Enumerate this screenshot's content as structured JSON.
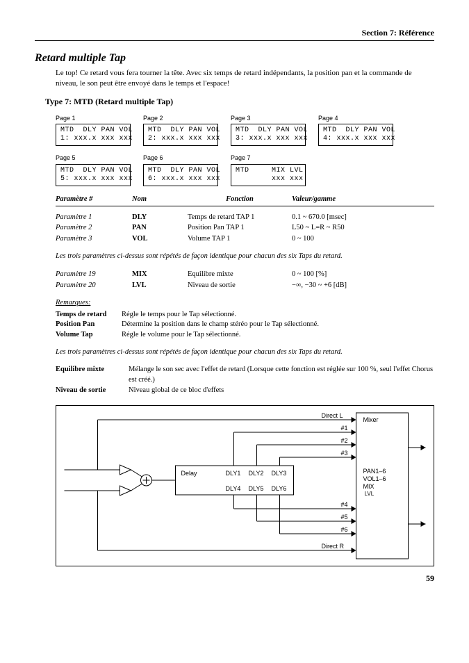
{
  "section_header": "Section 7: Référence",
  "title": "Retard multiple Tap",
  "intro": "Le top! Ce retard vous fera tourner la tête. Avec six temps de retard indépendants, la position pan et la commande de niveau, le son peut être envoyé dans le temps et l'espace!",
  "type_heading": "Type 7: MTD (Retard multiple Tap)",
  "pages": [
    {
      "label": "Page 1",
      "line1": "MTD  DLY PAN VOL",
      "line2": "1: xxx.x xxx xxx"
    },
    {
      "label": "Page 2",
      "line1": "MTD  DLY PAN VOL",
      "line2": "2: xxx.x xxx xxx"
    },
    {
      "label": "Page 3",
      "line1": "MTD  DLY PAN VOL",
      "line2": "3: xxx.x xxx xxx"
    },
    {
      "label": "Page 4",
      "line1": "MTD  DLY PAN VOL",
      "line2": "4: xxx.x xxx xxx"
    },
    {
      "label": "Page 5",
      "line1": "MTD  DLY PAN VOL",
      "line2": "5: xxx.x xxx xxx"
    },
    {
      "label": "Page 6",
      "line1": "MTD  DLY PAN VOL",
      "line2": "6: xxx.x xxx xxx"
    },
    {
      "label": "Page 7",
      "line1": "MTD     MIX LVL",
      "line2": "        xxx xxx"
    }
  ],
  "header": {
    "c1": "Paramètre #",
    "c2": "Nom",
    "c3": "Fonction",
    "c4": "Valeur/gamme"
  },
  "params1": [
    {
      "c1": "Paramètre 1",
      "c2": "DLY",
      "c3": "Temps de retard TAP 1",
      "c4": "0.1 ~ 670.0 [msec]"
    },
    {
      "c1": "Paramètre 2",
      "c2": "PAN",
      "c3": "Position Pan TAP 1",
      "c4": "L50 ~ L=R ~ R50"
    },
    {
      "c1": "Paramètre 3",
      "c2": "VOL",
      "c3": "Volume TAP 1",
      "c4": "0 ~ 100"
    }
  ],
  "note1": "Les trois paramètres ci-dessus sont répétés de façon identique pour chacun des six Taps du retard.",
  "params2": [
    {
      "c1": "Paramètre 19",
      "c2": "MIX",
      "c3": "Equilibre mixte",
      "c4": "0 ~ 100 [%]"
    },
    {
      "c1": "Paramètre 20",
      "c2": "LVL",
      "c3": "Niveau de sortie",
      "c4": "−∞, −30 ~ +6 [dB]"
    }
  ],
  "remarks_heading": "Remarques:",
  "remarks": [
    {
      "label": "Temps de retard",
      "text": "Régle le temps pour le Tap sélectionné."
    },
    {
      "label": "Position Pan",
      "text": "Détermine la position dans le champ stéréo pour le Tap sélectionné."
    },
    {
      "label": "Volume Tap",
      "text": "Régle le volume pour le Tap sélectionné."
    }
  ],
  "note2": "Les trois paramètres ci-dessus sont répétés de façon identique pour chacun des six Taps du retard.",
  "defs": [
    {
      "label": "Equilibre mixte",
      "text": "Mélange le son sec avec l'effet de retard (Lorsque cette fonction est réglée sur 100 %, seul l'effet Chorus est créé.)"
    },
    {
      "label": "Niveau de sortie",
      "text": "Niveau global de ce bloc d'effets"
    }
  ],
  "diagram": {
    "directL": "Direct L",
    "n1": "#1",
    "n2": "#2",
    "n3": "#3",
    "n4": "#4",
    "n5": "#5",
    "n6": "#6",
    "delay": "Delay",
    "dly1": "DLY1",
    "dly2": "DLY2",
    "dly3": "DLY3",
    "dly4": "DLY4",
    "dly5": "DLY5",
    "dly6": "DLY6",
    "directR": "Direct R",
    "mixer": "Mixer",
    "pan": "PAN1–6",
    "vol": "VOL1–6",
    "mix": "MIX",
    "lvl": "LVL"
  },
  "page_num": "59"
}
